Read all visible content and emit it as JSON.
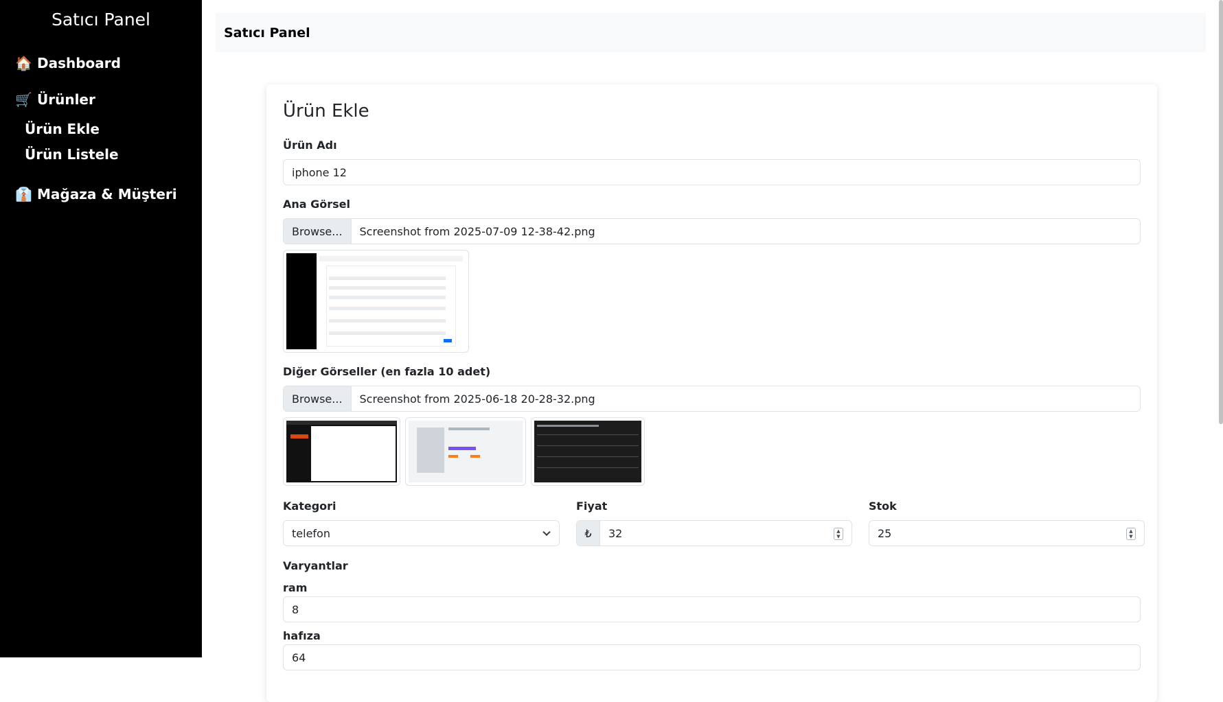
{
  "sidebar": {
    "brand": "Satıcı Panel",
    "dashboard": {
      "icon": "🏠",
      "label": "Dashboard"
    },
    "products": {
      "icon": "🛒",
      "label": "Ürünler"
    },
    "products_sub": [
      "Ürün Ekle",
      "Ürün Listele"
    ],
    "store": {
      "icon": "👔",
      "label": "Mağaza & Müşteri"
    }
  },
  "topbar": {
    "title": "Satıcı Panel"
  },
  "form": {
    "title": "Ürün Ekle",
    "name_label": "Ürün Adı",
    "name_value": "iphone 12",
    "main_image_label": "Ana Görsel",
    "browse_label": "Browse...",
    "main_image_file": "Screenshot from 2025-07-09 12-38-42.png",
    "other_images_label": "Diğer Görseller (en fazla 10 adet)",
    "other_images_file": "Screenshot from 2025-06-18 20-28-32.png",
    "category_label": "Kategori",
    "category_value": "telefon",
    "price_label": "Fiyat",
    "currency_symbol": "₺",
    "price_value": "32",
    "stock_label": "Stok",
    "stock_value": "25",
    "variants_label": "Varyantlar",
    "variants": [
      {
        "name": "ram",
        "value": "8"
      },
      {
        "name": "hafıza",
        "value": "64"
      }
    ]
  }
}
